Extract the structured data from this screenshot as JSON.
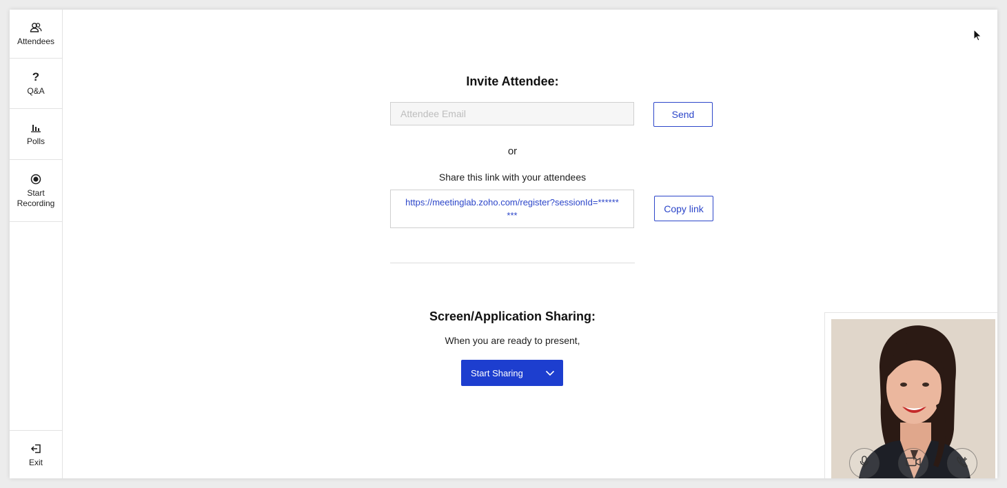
{
  "sidebar": {
    "attendees": {
      "label": "Attendees",
      "icon": "attendees-icon"
    },
    "qa": {
      "label": "Q&A",
      "icon": "question-icon"
    },
    "polls": {
      "label": "Polls",
      "icon": "poll-chart-icon"
    },
    "recording": {
      "label": "Start Recording",
      "icon": "record-icon"
    },
    "exit": {
      "label": "Exit",
      "icon": "exit-icon"
    }
  },
  "invite": {
    "title": "Invite Attendee:",
    "email_placeholder": "Attendee Email",
    "send_label": "Send",
    "or_text": "or",
    "share_text": "Share this link with your attendees",
    "link": "https://meetinglab.zoho.com/register?sessionId=*********",
    "copy_label": "Copy link"
  },
  "sharing": {
    "title": "Screen/Application Sharing:",
    "subtitle": "When you are ready to present,",
    "button_label": "Start Sharing"
  },
  "video": {
    "controls": [
      "microphone-icon",
      "video-camera-icon",
      "phone-add-icon"
    ]
  },
  "colors": {
    "accent": "#1d3ecf",
    "link": "#2b45c9"
  }
}
